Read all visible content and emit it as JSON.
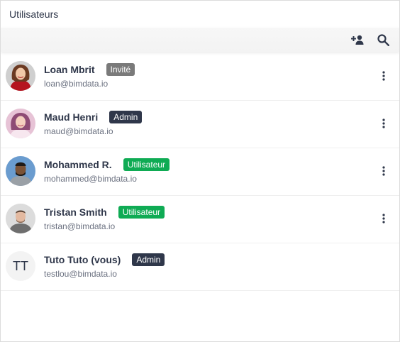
{
  "header": {
    "title": "Utilisateurs"
  },
  "toolbar": {
    "icons": [
      "add-user-icon",
      "search-icon"
    ]
  },
  "roles": {
    "guest": {
      "label": "Invité",
      "color": "#7a7a7a"
    },
    "admin": {
      "label": "Admin",
      "color": "#2f374a"
    },
    "user": {
      "label": "Utilisateur",
      "color": "#0fab54"
    }
  },
  "users": [
    {
      "name": "Loan Mbrit",
      "email": "loan@bimdata.io",
      "role": "Invité"
    },
    {
      "name": "Maud Henri",
      "email": "maud@bimdata.io",
      "role": "Admin"
    },
    {
      "name": "Mohammed R.",
      "email": "mohammed@bimdata.io",
      "role": "Utilisateur"
    },
    {
      "name": "Tristan Smith",
      "email": "tristan@bimdata.io",
      "role": "Utilisateur"
    },
    {
      "name": "Tuto Tuto (vous)",
      "email": "testlou@bimdata.io",
      "role": "Admin",
      "initials": "TT"
    }
  ]
}
